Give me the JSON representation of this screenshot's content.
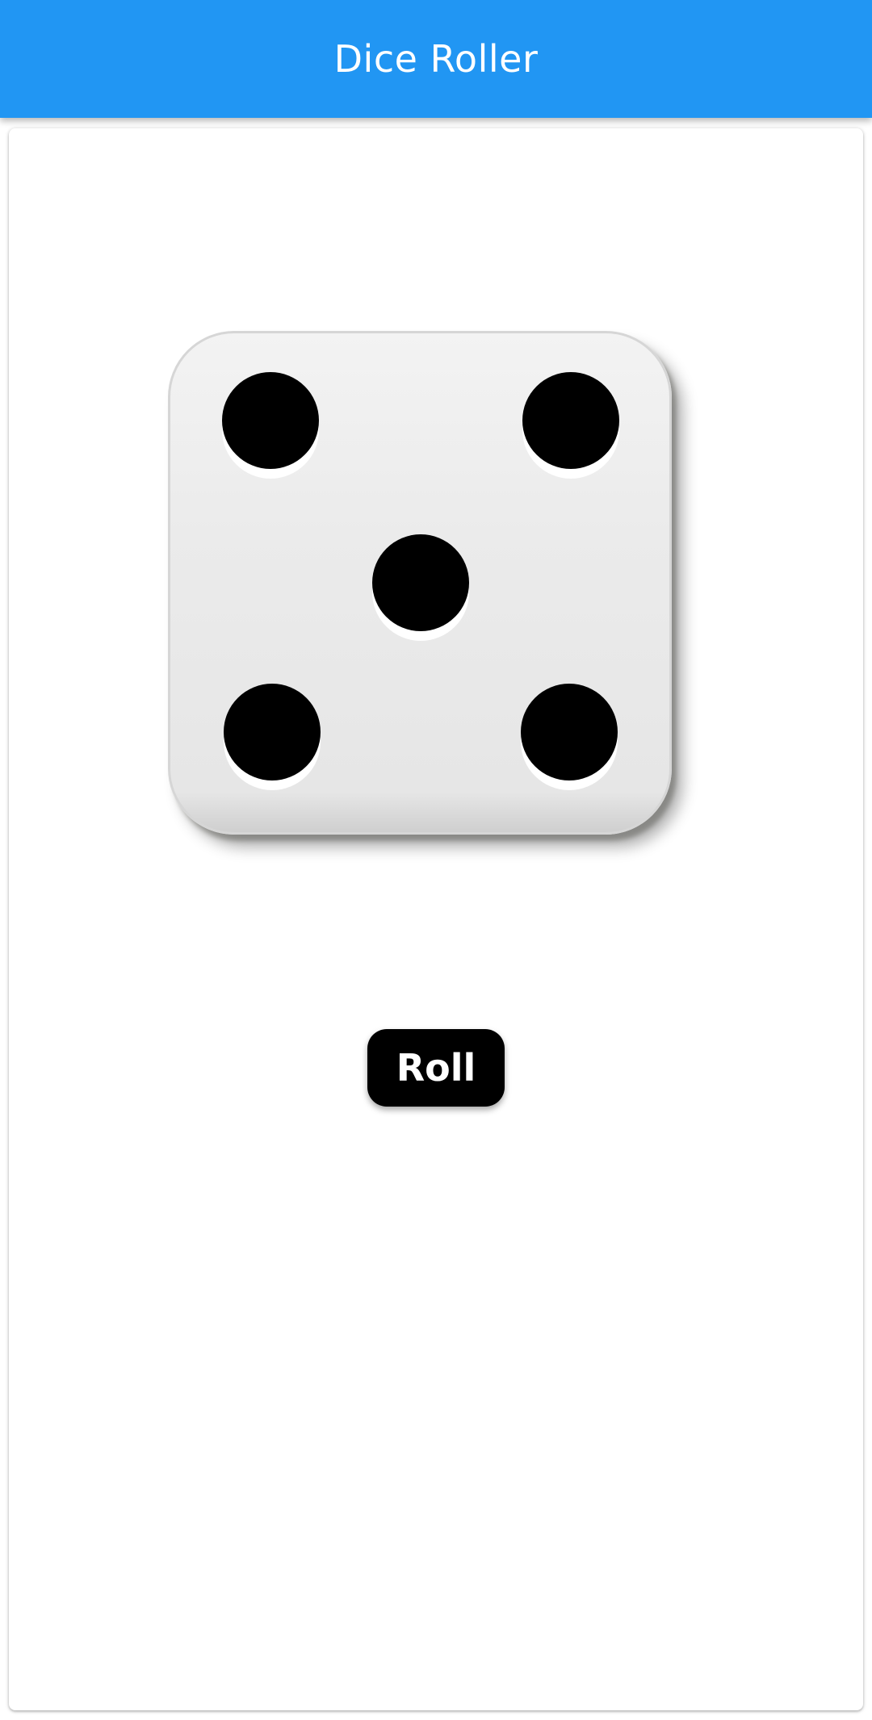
{
  "app_bar": {
    "title": "Dice Roller",
    "color": "#2196F3"
  },
  "die": {
    "face_value": 5,
    "pip_color": "#000000"
  },
  "roll_button": {
    "label": "Roll"
  }
}
